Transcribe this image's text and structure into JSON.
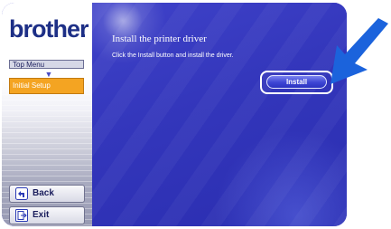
{
  "brand": {
    "logo_text": "brother"
  },
  "sidebar": {
    "top_menu_label": "Top Menu",
    "current_item_label": "Initial Setup",
    "back_label": "Back",
    "exit_label": "Exit"
  },
  "main": {
    "title": "Install the printer driver",
    "instruction": "Click the Install button and install the driver.",
    "install_button_label": "Install"
  },
  "colors": {
    "accent_blue": "#3336bb",
    "brand_navy": "#1d2f86",
    "highlight_orange": "#f4a422",
    "pointer_arrow": "#1b63dc"
  }
}
